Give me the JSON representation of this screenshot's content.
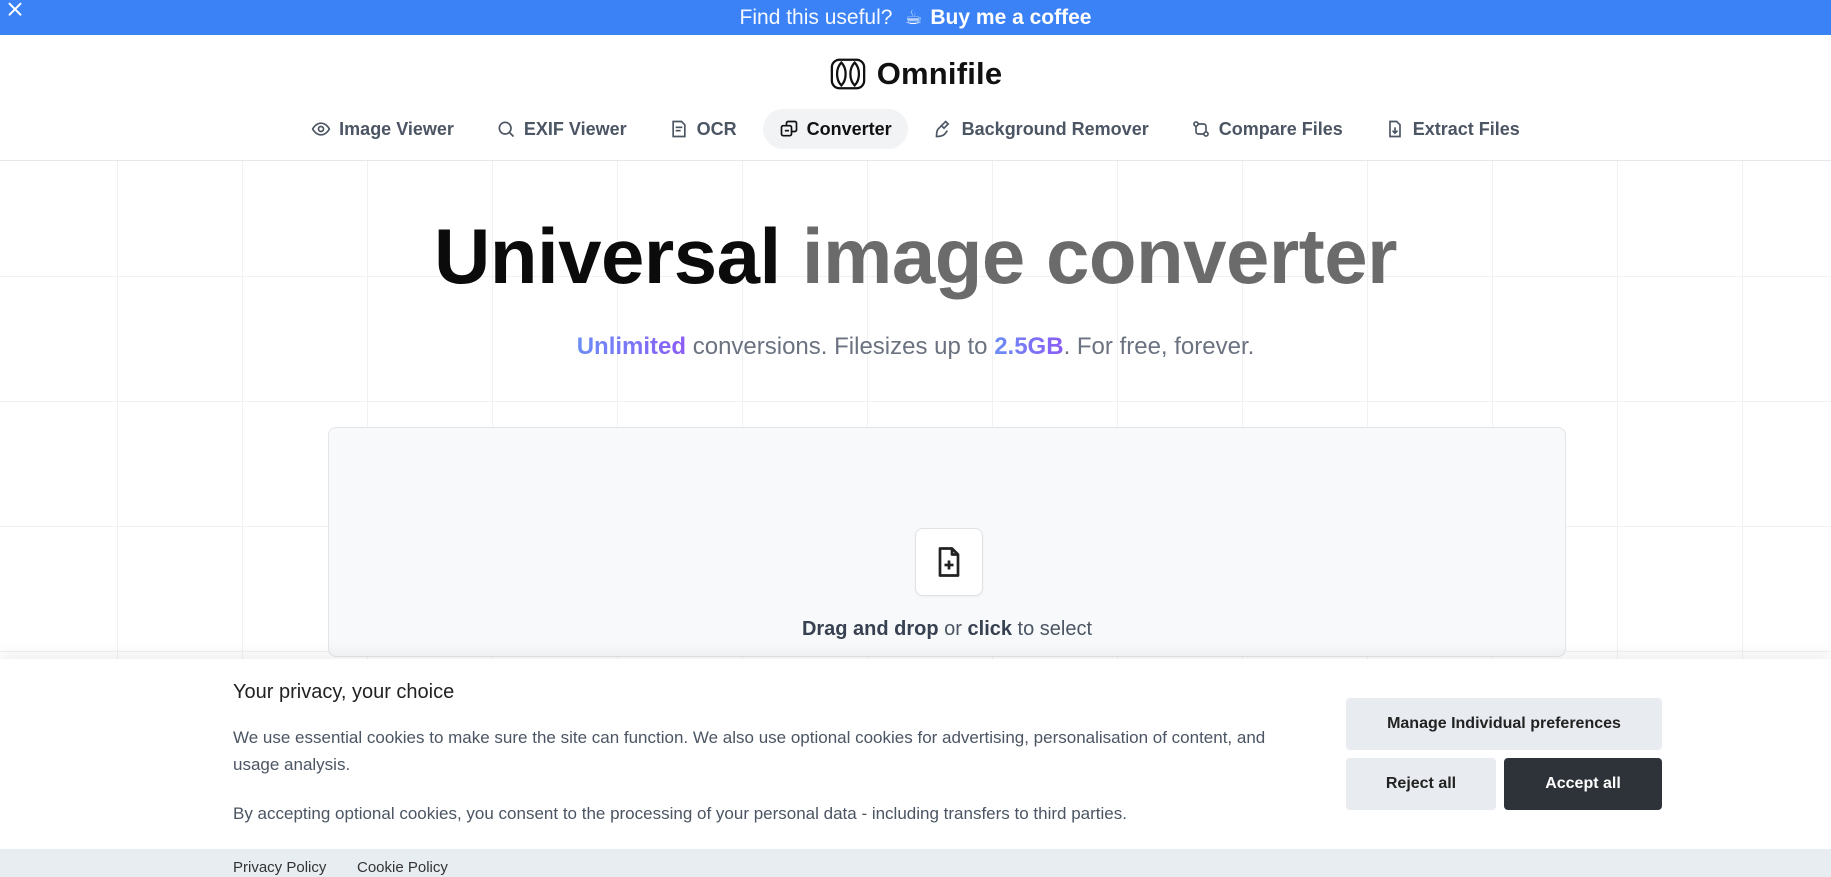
{
  "promo": {
    "question": "Find this useful?",
    "coffee_emoji": "☕",
    "link": "Buy me a coffee",
    "bg_color": "#3b82f6"
  },
  "brand": {
    "name": "Omnifile"
  },
  "nav": {
    "items": [
      {
        "label": "Image Viewer",
        "icon": "eye-icon"
      },
      {
        "label": "EXIF Viewer",
        "icon": "search-icon"
      },
      {
        "label": "OCR",
        "icon": "document-text-icon"
      },
      {
        "label": "Converter",
        "icon": "convert-icon",
        "active": true
      },
      {
        "label": "Background Remover",
        "icon": "brush-icon"
      },
      {
        "label": "Compare Files",
        "icon": "git-compare-icon"
      },
      {
        "label": "Extract Files",
        "icon": "file-extract-icon"
      }
    ]
  },
  "hero": {
    "title_dark": "Universal",
    "title_gray": "image converter",
    "sub_highlight1": "Unlimited",
    "sub_text1": " conversions. Filesizes up to ",
    "sub_highlight2": "2.5GB",
    "sub_text2": ". For free, forever."
  },
  "dropzone": {
    "icon": "file-plus-icon",
    "hint_bold1": "Drag and drop",
    "hint_mid": " or ",
    "hint_bold2": "click",
    "hint_end": " to select"
  },
  "cookie": {
    "title": "Your privacy, your choice",
    "p1": "We use essential cookies to make sure the site can function. We also use optional cookies for advertising, personalisation of content, and usage analysis.",
    "p2": "By accepting optional cookies, you consent to the processing of your personal data - including transfers to third parties.",
    "manage": "Manage Individual preferences",
    "reject": "Reject all",
    "accept": "Accept all",
    "privacy_link": "Privacy Policy",
    "cookie_link": "Cookie Policy"
  }
}
